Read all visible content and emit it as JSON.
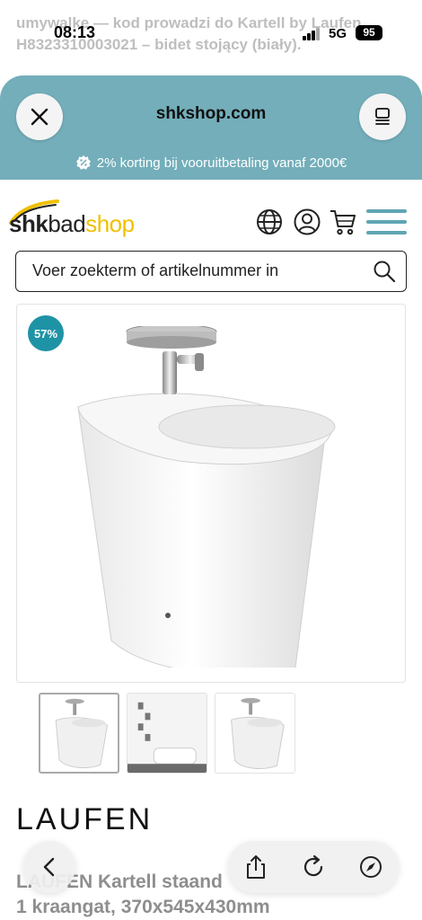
{
  "background": {
    "line1": "umywalke — kod prowadzi do Kartell by Laufen",
    "line2": "H8323310003021 – bidet stojący (biały)."
  },
  "status_bar": {
    "time": "08:13",
    "network": "5G",
    "battery": "95"
  },
  "browser": {
    "domain": "shkshop.com",
    "promo_text": "2% korting bij vooruitbetaling vanaf 2000€",
    "close_icon": "close-icon",
    "menu_icon": "page-menu-icon"
  },
  "site": {
    "logo": {
      "part1": "shk",
      "part2": "bad",
      "part3": "shop"
    },
    "search_placeholder": "Voer zoekterm of artikelnummer in",
    "colors": {
      "accent": "#5fa6b3",
      "logo_yellow": "#f0c000",
      "badge": "#1f93a6"
    }
  },
  "product": {
    "discount_badge": "57%",
    "brand": "LAUFEN",
    "title_line1": "LAUFEN Kartell staand",
    "title_line2": "1 kraangat, 370x545x430mm"
  },
  "toolbar": {
    "back_icon": "chevron-left-icon",
    "share_icon": "share-icon",
    "reload_icon": "reload-icon",
    "compass_icon": "compass-icon"
  }
}
